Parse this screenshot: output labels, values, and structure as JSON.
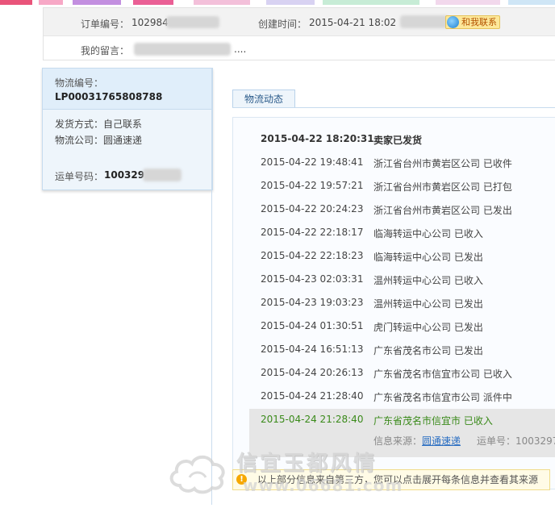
{
  "order": {
    "order_no_label": "订单编号：",
    "order_no_value": "102984.",
    "created_label": "创建时间：",
    "created_value": "2015-04-21 18:02",
    "contact_button": "和我联系",
    "message_label": "我的留言：",
    "message_value": "...."
  },
  "logistics": {
    "id_label": "物流编号：",
    "id_value": "LP00031765808788",
    "ship_method": "发货方式：自己联系",
    "company": "物流公司：圆通速递",
    "waybill_label": "运单号码：",
    "waybill_value": "100329."
  },
  "tab": {
    "label": "物流动态"
  },
  "tracking": [
    {
      "time": "2015-04-22 18:20:31",
      "status": "卖家已发货"
    },
    {
      "time": "2015-04-22 19:48:41",
      "status": "浙江省台州市黄岩区公司 已收件"
    },
    {
      "time": "2015-04-22 19:57:21",
      "status": "浙江省台州市黄岩区公司 已打包"
    },
    {
      "time": "2015-04-22 20:24:23",
      "status": "浙江省台州市黄岩区公司 已发出"
    },
    {
      "time": "2015-04-22 22:18:17",
      "status": "临海转运中心公司 已收入"
    },
    {
      "time": "2015-04-22 22:18:23",
      "status": "临海转运中心公司 已发出"
    },
    {
      "time": "2015-04-23 02:03:31",
      "status": "温州转运中心公司 已收入"
    },
    {
      "time": "2015-04-23 19:03:23",
      "status": "温州转运中心公司 已发出"
    },
    {
      "time": "2015-04-24 01:30:51",
      "status": "虎门转运中心公司 已发出"
    },
    {
      "time": "2015-04-24 16:51:13",
      "status": "广东省茂名市公司 已发出"
    },
    {
      "time": "2015-04-24 20:26:13",
      "status": "广东省茂名市信宜市公司 已收入"
    },
    {
      "time": "2015-04-24 21:28:40",
      "status": "广东省茂名市信宜市公司 派件中"
    },
    {
      "time": "2015-04-24 21:28:40",
      "status": "广东省茂名市信宜市 已收入"
    }
  ],
  "source": {
    "label": "信息来源：",
    "link": "圆通速递",
    "waybill_label": "运单号：1003297"
  },
  "notice": {
    "text": "以上部分信息来自第三方，您可以点击展开每条信息并查看其来源"
  },
  "watermark": {
    "title": "信宜玉都风情",
    "url": "www.06681.com"
  },
  "colors": {
    "accent_blue": "#2a6ec2",
    "highlight_green": "#3a8a1a",
    "panel_blue": "#e0eefa",
    "notice_yellow": "#fffbe6"
  }
}
